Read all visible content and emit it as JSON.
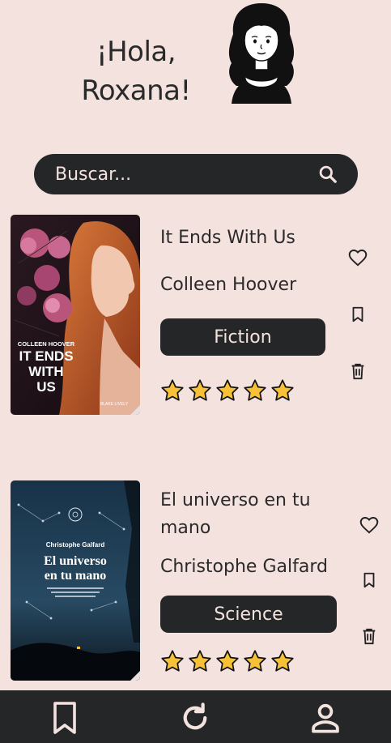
{
  "header": {
    "greeting_line1": "¡Hola,",
    "greeting_line2": "Roxana!"
  },
  "search": {
    "placeholder": "Buscar..."
  },
  "books": [
    {
      "title": "It Ends With Us",
      "author": "Colleen Hoover",
      "genre": "Fiction",
      "rating": 5,
      "cover": {
        "author_caps": "COLLEEN HOOVER",
        "title_line1": "IT ENDS",
        "title_line2": "WITH",
        "title_line3": "US",
        "footer": "BLAKE LIVELY"
      }
    },
    {
      "title": "El universo en tu mano",
      "author": "Christophe Galfard",
      "genre": "Science",
      "rating": 5,
      "cover": {
        "author": "Christophe Galfard",
        "title_line1": "El universo",
        "title_line2": "en tu mano"
      }
    }
  ],
  "colors": {
    "background": "#f4e2df",
    "dark": "#252628",
    "star": "#f6c136"
  },
  "icons": {
    "search": "search-icon",
    "favorite": "heart-icon",
    "bookmark": "bookmark-icon",
    "delete": "trash-icon",
    "nav_saved": "bookmark-icon",
    "nav_refresh": "refresh-icon",
    "nav_profile": "user-icon"
  }
}
